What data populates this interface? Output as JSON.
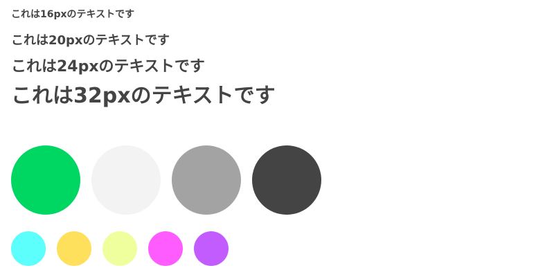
{
  "texts": [
    "これは16pxのテキストです",
    "これは20pxのテキストです",
    "これは24pxのテキストです",
    "これは32pxのテキストです"
  ],
  "large_swatches": [
    "#00D662",
    "#F3F3F3",
    "#A3A3A3",
    "#444444"
  ],
  "small_swatches": [
    "#5CFFFC",
    "#FFE05C",
    "#F0FF9E",
    "#FF5CFF",
    "#C25CFF"
  ]
}
